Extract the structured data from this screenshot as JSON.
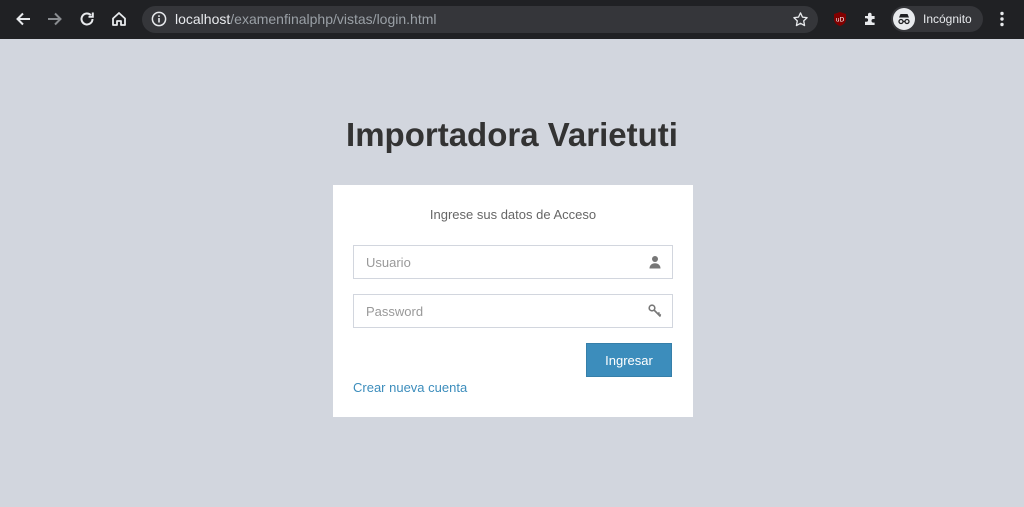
{
  "browser": {
    "url_host": "localhost",
    "url_path": "/examenfinalphp/vistas/login.html",
    "incognito_label": "Incógnito",
    "extension_badge": "uD",
    "icons": {
      "back": "arrow-left-icon",
      "forward": "arrow-right-icon",
      "reload": "reload-icon",
      "home": "home-icon",
      "info": "info-icon",
      "star": "star-icon",
      "puzzle": "puzzle-icon",
      "menu": "kebab-menu-icon"
    }
  },
  "page": {
    "title": "Importadora Varietuti",
    "login_message": "Ingrese sus datos de Acceso",
    "username": {
      "placeholder": "Usuario",
      "value": "",
      "icon": "user-icon"
    },
    "password": {
      "placeholder": "Password",
      "value": "",
      "icon": "key-icon"
    },
    "submit_label": "Ingresar",
    "register_link": "Crear nueva cuenta"
  },
  "colors": {
    "page_bg": "#d2d6de",
    "accent": "#3c8dbc",
    "chrome_bg": "#202124"
  }
}
